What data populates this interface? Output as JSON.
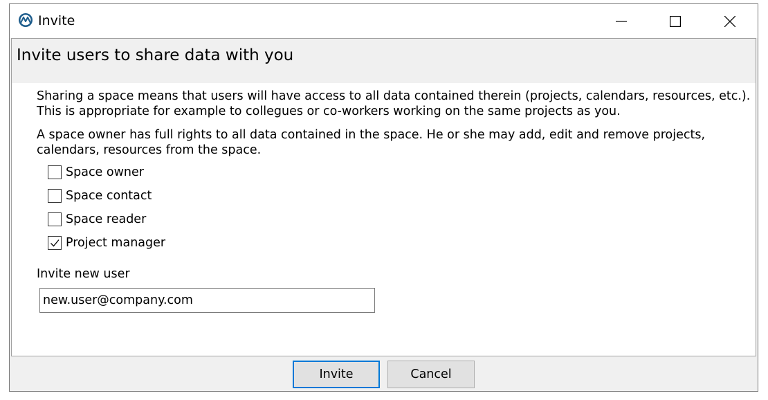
{
  "window": {
    "title": "Invite",
    "icon": "app-logo-icon",
    "controls": {
      "minimize": "minimize-icon",
      "maximize": "maximize-icon",
      "close": "close-icon"
    }
  },
  "header": {
    "title": "Invite users to share data with you"
  },
  "body": {
    "paragraph1": "Sharing a space means that users will have access to all data contained therein (projects, calendars, resources, etc.). This is appropriate for example to collegues or co-workers working on the same projects as you.",
    "paragraph2": "A space owner has full rights to all data contained in the space. He or she may add, edit and remove projects, calendars, resources from the space."
  },
  "options": [
    {
      "label": "Space owner",
      "checked": false
    },
    {
      "label": "Space contact",
      "checked": false
    },
    {
      "label": "Space reader",
      "checked": false
    },
    {
      "label": "Project manager",
      "checked": true
    }
  ],
  "invite": {
    "label": "Invite new user",
    "value": "new.user@company.com"
  },
  "buttons": {
    "invite": "Invite",
    "cancel": "Cancel"
  },
  "colors": {
    "accent": "#0078d7",
    "icon_blue": "#1e5d8c"
  }
}
